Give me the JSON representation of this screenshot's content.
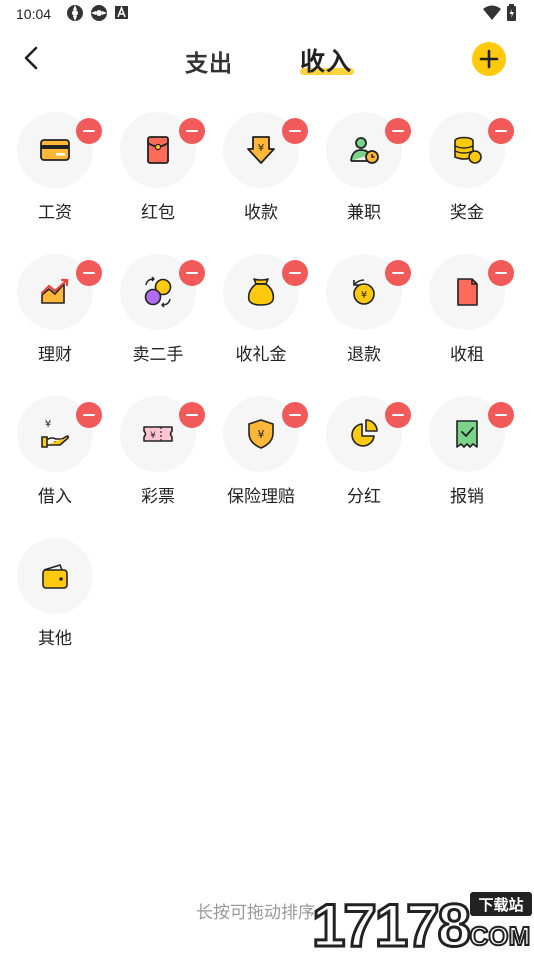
{
  "status_bar": {
    "time": "10:04",
    "battery_text": ""
  },
  "header": {
    "tab_expense": "支出",
    "tab_income": "收入"
  },
  "categories": [
    {
      "label": "工资",
      "icon": "card-icon"
    },
    {
      "label": "红包",
      "icon": "red-envelope-icon"
    },
    {
      "label": "收款",
      "icon": "receive-money-icon"
    },
    {
      "label": "兼职",
      "icon": "part-time-icon"
    },
    {
      "label": "奖金",
      "icon": "coins-icon"
    },
    {
      "label": "理财",
      "icon": "investment-chart-icon"
    },
    {
      "label": "卖二手",
      "icon": "exchange-icon"
    },
    {
      "label": "收礼金",
      "icon": "money-bag-icon"
    },
    {
      "label": "退款",
      "icon": "refund-icon"
    },
    {
      "label": "收租",
      "icon": "rent-icon"
    },
    {
      "label": "借入",
      "icon": "borrow-hand-icon"
    },
    {
      "label": "彩票",
      "icon": "lottery-ticket-icon"
    },
    {
      "label": "保险理赔",
      "icon": "insurance-shield-icon"
    },
    {
      "label": "分红",
      "icon": "pie-chart-icon"
    },
    {
      "label": "报销",
      "icon": "reimburse-receipt-icon"
    },
    {
      "label": "其他",
      "icon": "wallet-icon"
    }
  ],
  "hint": "长按可拖动排序",
  "watermark": {
    "text": "17178",
    "sub": "下载站",
    "domain": "COM"
  },
  "colors": {
    "accent": "#FFC90E",
    "badge": "#F25A5A",
    "icon_orange": "#FFB739",
    "icon_purple": "#B06CF5"
  }
}
